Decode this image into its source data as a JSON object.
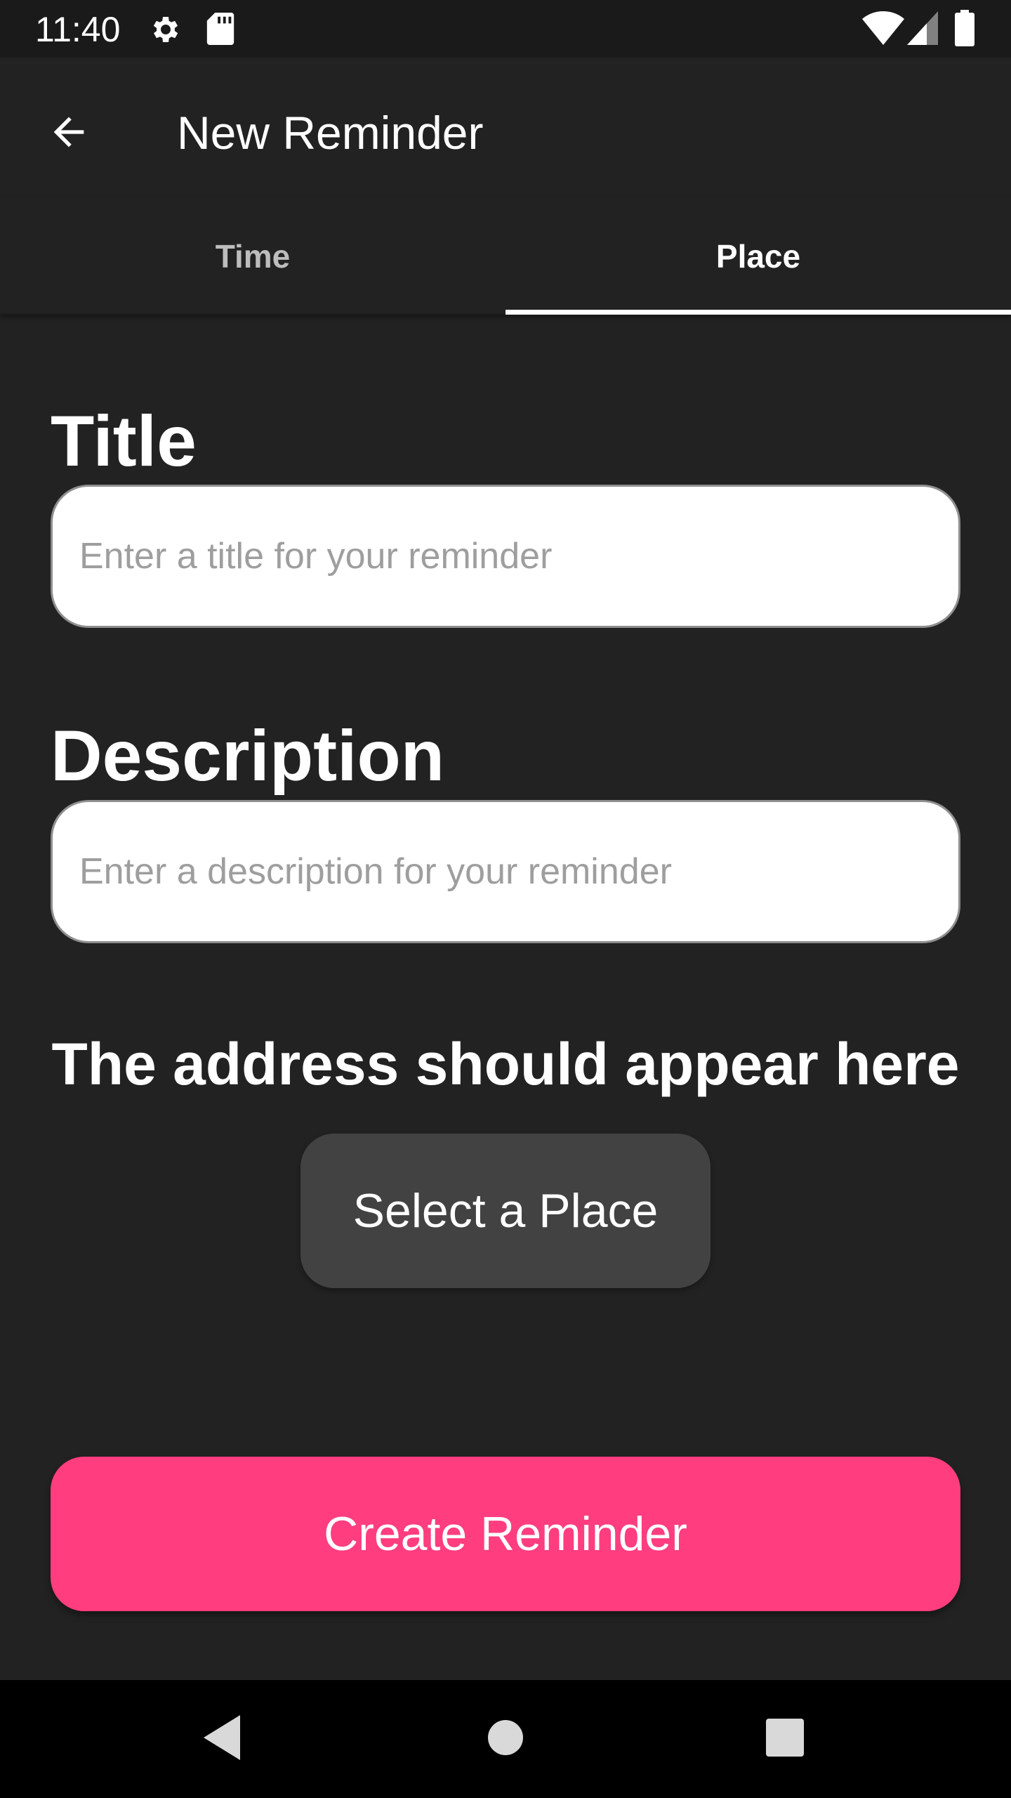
{
  "status_bar": {
    "time": "11:40",
    "icons": [
      "settings-icon",
      "sd-card-icon",
      "wifi-icon",
      "signal-icon",
      "battery-icon"
    ]
  },
  "app_bar": {
    "back_icon": "arrow-back-icon",
    "title": "New Reminder"
  },
  "tabs": {
    "items": [
      {
        "label": "Time",
        "selected": false
      },
      {
        "label": "Place",
        "selected": true
      }
    ]
  },
  "form": {
    "title_label": "Title",
    "title_input": {
      "value": "",
      "placeholder": "Enter a title for your reminder"
    },
    "description_label": "Description",
    "description_input": {
      "value": "",
      "placeholder": "Enter a description for your reminder"
    },
    "address_text": "The address should appear here",
    "select_place_label": "Select a Place",
    "create_label": "Create Reminder"
  },
  "colors": {
    "background": "#222222",
    "accent": "#ff3d7f",
    "secondary_button": "#424242"
  },
  "nav_bar": {
    "icons": [
      "nav-back-icon",
      "nav-home-icon",
      "nav-recents-icon"
    ]
  }
}
